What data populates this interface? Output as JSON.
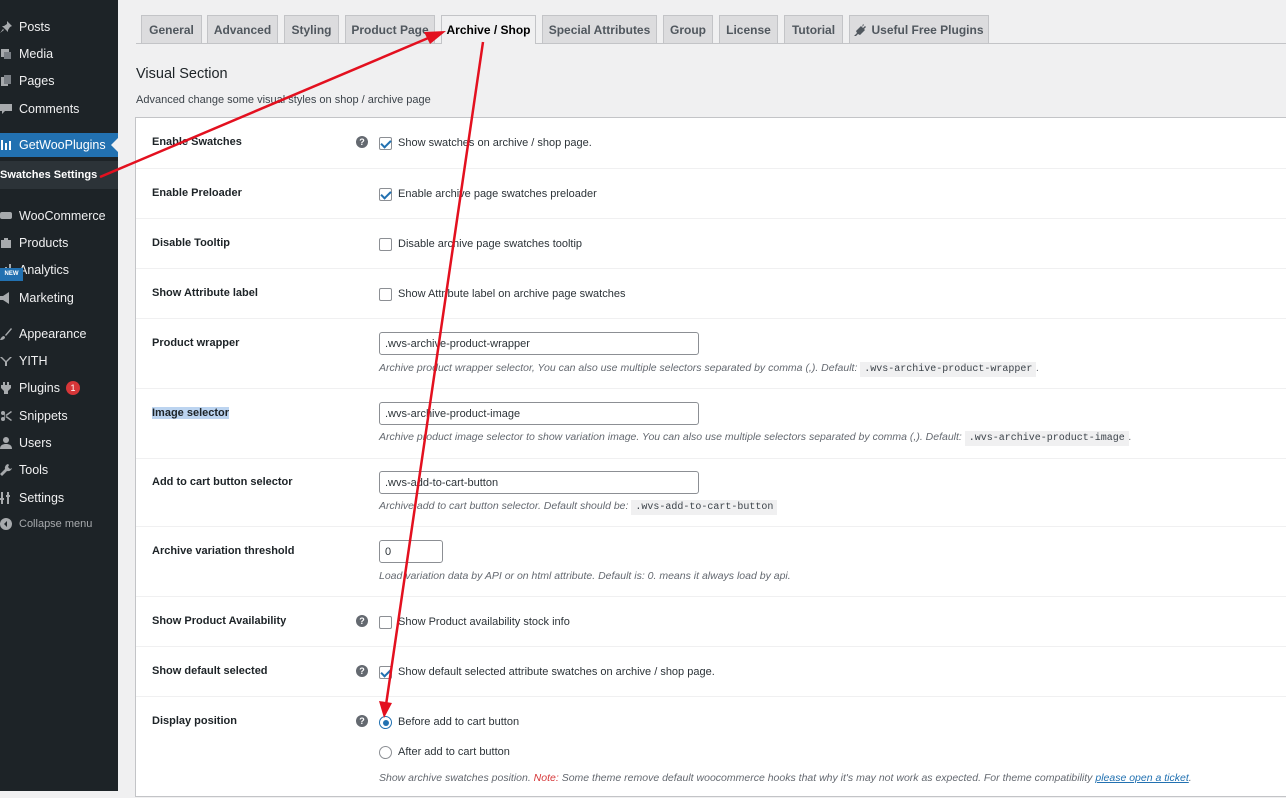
{
  "sidebar": {
    "items": [
      {
        "label": "Posts",
        "icon": "pushpin-icon"
      },
      {
        "label": "Media",
        "icon": "media-icon"
      },
      {
        "label": "Pages",
        "icon": "pages-icon"
      },
      {
        "label": "Comments",
        "icon": "comment-icon"
      },
      {
        "label": "GetWooPlugins",
        "icon": "plugin-menu-icon"
      },
      {
        "label": "Swatches Settings"
      },
      {
        "label": "WooCommerce",
        "icon": "woo-icon"
      },
      {
        "label": "Products",
        "icon": "products-icon"
      },
      {
        "label": "Analytics",
        "icon": "analytics-icon"
      },
      {
        "label": "Marketing",
        "icon": "megaphone-icon"
      },
      {
        "label": "Appearance",
        "icon": "brush-icon"
      },
      {
        "label": "YITH",
        "icon": "yith-icon"
      },
      {
        "label": "Plugins",
        "icon": "plugins-icon",
        "badge": "1"
      },
      {
        "label": "Snippets",
        "icon": "scissors-icon"
      },
      {
        "label": "Users",
        "icon": "users-icon"
      },
      {
        "label": "Tools",
        "icon": "wrench-icon"
      },
      {
        "label": "Settings",
        "icon": "settings-icon"
      },
      {
        "label": "Collapse menu",
        "icon": "collapse-icon"
      }
    ]
  },
  "tabs": [
    "General",
    "Advanced",
    "Styling",
    "Product Page",
    "Archive / Shop",
    "Special Attributes",
    "Group",
    "License",
    "Tutorial",
    "Useful Free Plugins"
  ],
  "active_tab": "Archive / Shop",
  "section": {
    "title": "Visual Section",
    "description": "Advanced change some visual styles on shop / archive page"
  },
  "new_badge": "NEW",
  "rows": {
    "enable_swatches": {
      "label": "Enable Swatches",
      "text": "Show swatches on archive / shop page.",
      "checked": true
    },
    "enable_preloader": {
      "label": "Enable Preloader",
      "text": "Enable archive page swatches preloader",
      "checked": true
    },
    "disable_tooltip": {
      "label": "Disable Tooltip",
      "text": "Disable archive page swatches tooltip",
      "checked": false
    },
    "show_attribute_label": {
      "label": "Show Attribute label",
      "text": "Show Attribute label on archive page swatches",
      "checked": false
    },
    "product_wrapper": {
      "label": "Product wrapper",
      "value": ".wvs-archive-product-wrapper",
      "desc": "Archive product wrapper selector, You can also use multiple selectors separated by comma (,). Default:",
      "default": ".wvs-archive-product-wrapper",
      "desc_end": "."
    },
    "image_selector": {
      "label": "Image selector",
      "value": ".wvs-archive-product-image",
      "desc": "Archive product image selector to show variation image. You can also use multiple selectors separated by comma (,). Default:",
      "default": ".wvs-archive-product-image",
      "desc_end": "."
    },
    "add_to_cart": {
      "label": "Add to cart button selector",
      "value": ".wvs-add-to-cart-button",
      "desc": "Archive add to cart button selector. Default should be:",
      "default": ".wvs-add-to-cart-button"
    },
    "variation_threshold": {
      "label": "Archive variation threshold",
      "value": "0",
      "desc": "Load variation data by API or on html attribute. Default is: 0. means it always load by api."
    },
    "show_availability": {
      "label": "Show Product Availability",
      "text": "Show Product availability stock info",
      "checked": false
    },
    "show_default_selected": {
      "label": "Show default selected",
      "text": "Show default selected attribute swatches on archive / shop page.",
      "checked": true
    },
    "display_position": {
      "label": "Display position",
      "options": [
        "Before add to cart button",
        "After add to cart button"
      ],
      "selected": "Before add to cart button",
      "desc": "Show archive swatches position.",
      "note_label": "Note:",
      "note": "Some theme remove default woocommerce hooks that why it's may not work as expected. For theme compatibility",
      "link": "please open a ticket",
      "desc_end": "."
    }
  },
  "colors": {
    "sidebar_bg": "#1d2327",
    "accent": "#2271b1",
    "annotation_arrow": "#e3101f"
  }
}
